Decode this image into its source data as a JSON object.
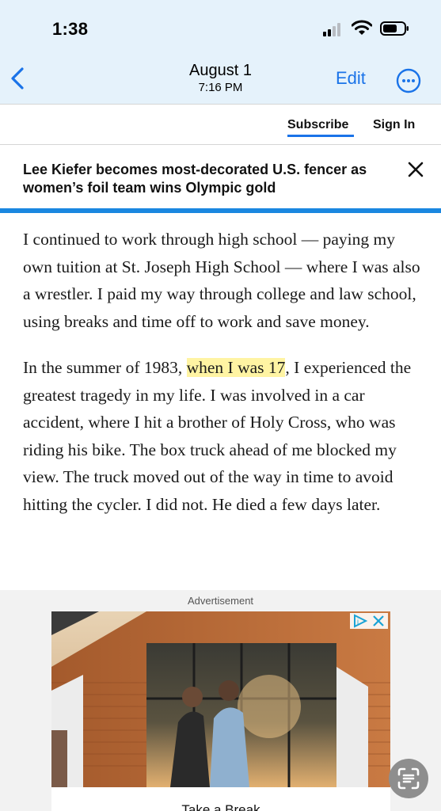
{
  "status_bar": {
    "time": "1:38"
  },
  "nav": {
    "title": "August 1",
    "subtitle": "7:16 PM",
    "edit_label": "Edit"
  },
  "header": {
    "subscribe_label": "Subscribe",
    "signin_label": "Sign In"
  },
  "banner": {
    "headline": "Lee Kiefer becomes most-decorated U.S. fencer as women’s foil team wins Olympic gold"
  },
  "article": {
    "p1": "I continued to work through high school — paying my own tuition at St. Joseph High School — where I was also a wrestler. I paid my way through college and law school, using breaks and time off to work and save money.",
    "p2_before": "In the summer of 1983, ",
    "p2_highlight": "when I was 17",
    "p2_after": ", I experienced the greatest tragedy in my life. I was involved in a car accident, where I hit a brother of Holy Cross, who was riding his bike. The box truck ahead of me blocked my view. The truck moved out of the way in time to avoid hitting the cycler. I did not. He died a few days later."
  },
  "ad": {
    "label": "Advertisement",
    "cta": "Take a Break"
  },
  "colors": {
    "accent": "#1a73e8",
    "banner_rule": "#1a87e0",
    "highlight": "#fff4a3",
    "nav_background": "#e5f2fb"
  },
  "icons": {
    "back": "chevron-left-icon",
    "more": "ellipsis-circle-icon",
    "close": "close-icon",
    "scan": "text-scan-icon"
  }
}
